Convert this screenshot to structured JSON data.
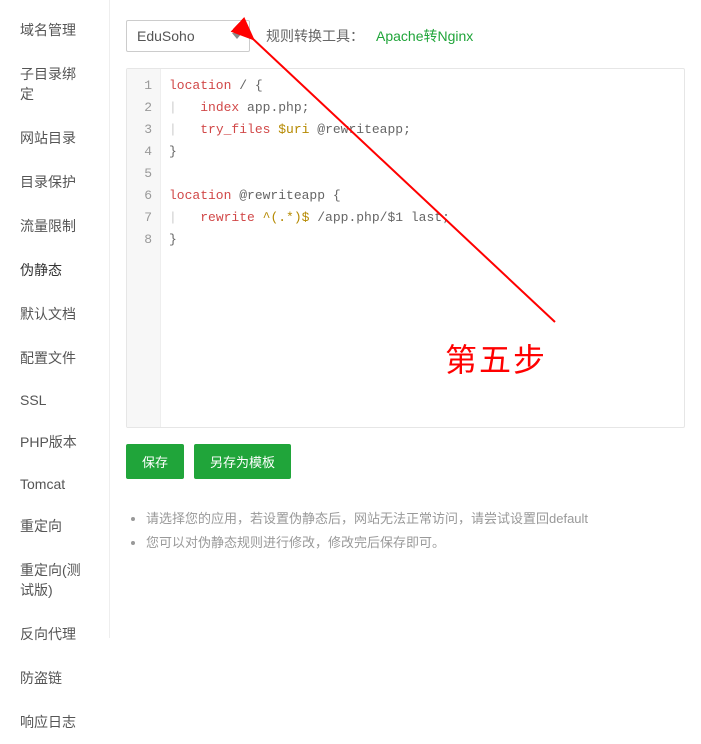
{
  "sidebar": {
    "items": [
      {
        "label": "域名管理"
      },
      {
        "label": "子目录绑定"
      },
      {
        "label": "网站目录"
      },
      {
        "label": "目录保护"
      },
      {
        "label": "流量限制"
      },
      {
        "label": "伪静态"
      },
      {
        "label": "默认文档"
      },
      {
        "label": "配置文件"
      },
      {
        "label": "SSL"
      },
      {
        "label": "PHP版本"
      },
      {
        "label": "Tomcat"
      },
      {
        "label": "重定向"
      },
      {
        "label": "重定向(测试版)"
      },
      {
        "label": "反向代理"
      },
      {
        "label": "防盗链"
      },
      {
        "label": "响应日志"
      }
    ],
    "active_index": 5
  },
  "top": {
    "select_value": "EduSoho",
    "convert_label": "规则转换工具：",
    "convert_link_text": "Apache转Nginx"
  },
  "editor": {
    "lines_html": [
      "<span class=\"kw-loc\">location</span> / {",
      "<span class=\"indent-bar\">|</span>   <span class=\"kw-dir\">index</span> app.php;",
      "<span class=\"indent-bar\">|</span>   <span class=\"kw-dir\">try_files</span> <span class=\"kw-var\">$uri</span> @rewriteapp;",
      "}",
      "",
      "<span class=\"kw-loc\">location</span> @rewriteapp {",
      "<span class=\"indent-bar\">|</span>   <span class=\"kw-dir\">rewrite</span> <span class=\"kw-var\">^(.*)$</span> /app.php/$1 last;",
      "}"
    ]
  },
  "buttons": {
    "save": "保存",
    "save_as": "另存为模板"
  },
  "notes": {
    "items": [
      "请选择您的应用，若设置伪静态后，网站无法正常访问，请尝试设置回default",
      "您可以对伪静态规则进行修改，修改完后保存即可。"
    ]
  },
  "annotation": {
    "step_label": "第五步"
  }
}
